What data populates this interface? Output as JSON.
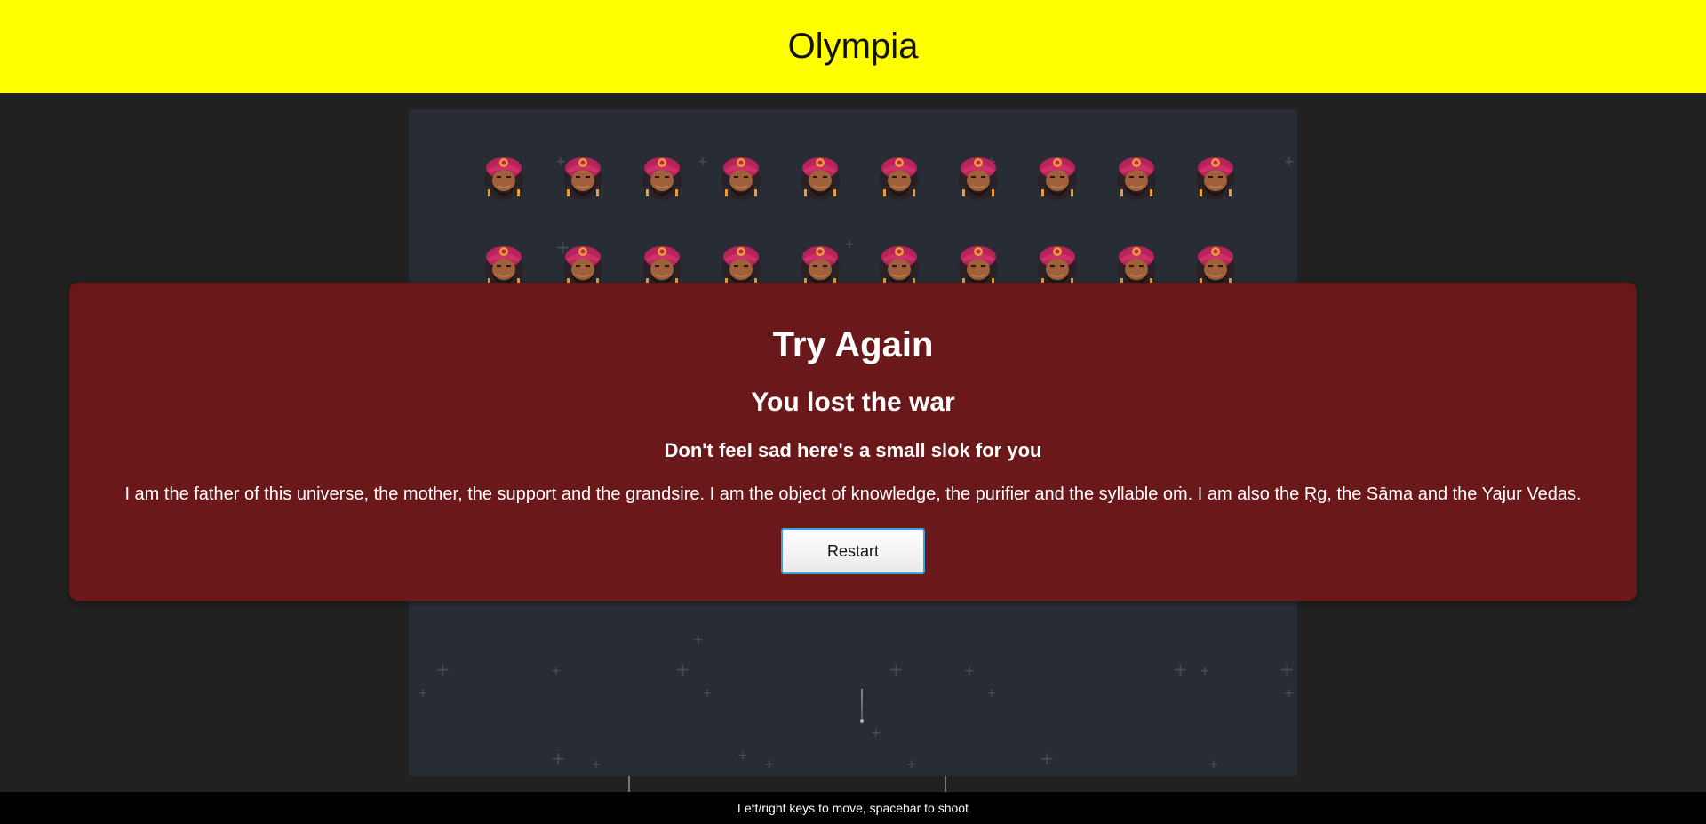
{
  "header": {
    "title": "Olympia",
    "background": "#ffff00"
  },
  "game": {
    "background": "#282c34",
    "enemy_rows": 2,
    "enemies_per_row": 10,
    "enemy_icon": "turbaned-warrior-face-icon",
    "projectile_icon": "arrow-projectile"
  },
  "modal": {
    "title": "Try Again",
    "subtitle": "You lost the war",
    "prompt": "Don't feel sad here's a small slok for you",
    "verse": "I am the father of this universe, the mother, the support and the grandsire. I am the object of knowledge, the purifier and the syllable oṁ. I am also the Ṛg, the Sāma and the Yajur Vedas.",
    "restart_label": "Restart",
    "background": "#6a181a"
  },
  "footer": {
    "instructions": "Left/right keys to move, spacebar to shoot"
  }
}
